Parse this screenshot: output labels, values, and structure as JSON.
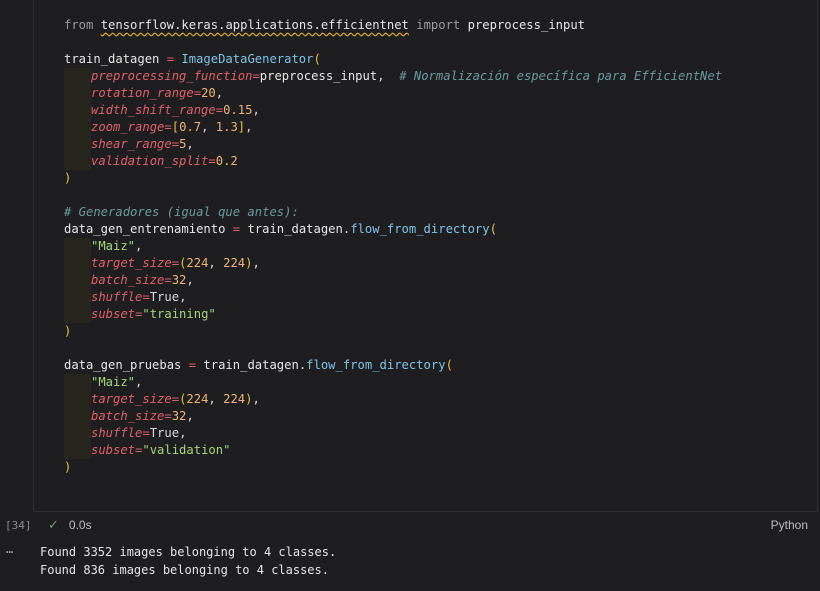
{
  "cell": {
    "execution_count": "[34]",
    "status": "0.0s",
    "language": "Python"
  },
  "code": {
    "l1": {
      "from": "from",
      "module": "tensorflow.keras.applications.efficientnet",
      "import": "import",
      "name": "preprocess_input"
    },
    "l2": {
      "var": "train_datagen",
      "eq": " = ",
      "call": "ImageDataGenerator",
      "open": "("
    },
    "l3": {
      "param": "preprocessing_function",
      "eq": "=",
      "value": "preprocess_input",
      "comma": ",  ",
      "comment": "# Normalización específica para EfficientNet"
    },
    "l4": {
      "param": "rotation_range",
      "eq": "=",
      "value": "20",
      "comma": ","
    },
    "l5": {
      "param": "width_shift_range",
      "eq": "=",
      "value": "0.15",
      "comma": ","
    },
    "l6": {
      "param": "zoom_range",
      "eq": "=",
      "open": "[",
      "v1": "0.7",
      "sep": ", ",
      "v2": "1.3",
      "close": "]",
      "comma": ","
    },
    "l7": {
      "param": "shear_range",
      "eq": "=",
      "value": "5",
      "comma": ","
    },
    "l8": {
      "param": "validation_split",
      "eq": "=",
      "value": "0.2"
    },
    "l9": {
      "close": ")"
    },
    "l10": {
      "comment": "# Generadores (igual que antes):"
    },
    "l11": {
      "var": "data_gen_entrenamiento",
      "eq": " = ",
      "obj": "train_datagen",
      "dot": ".",
      "method": "flow_from_directory",
      "open": "("
    },
    "l12": {
      "str": "\"Maiz\"",
      "comma": ","
    },
    "l13": {
      "param": "target_size",
      "eq": "=",
      "open": "(",
      "v1": "224",
      "sep": ", ",
      "v2": "224",
      "close": ")",
      "comma": ","
    },
    "l14": {
      "param": "batch_size",
      "eq": "=",
      "value": "32",
      "comma": ","
    },
    "l15": {
      "param": "shuffle",
      "eq": "=",
      "value": "True",
      "comma": ","
    },
    "l16": {
      "param": "subset",
      "eq": "=",
      "value": "\"training\""
    },
    "l17": {
      "close": ")"
    },
    "l18": {
      "var": "data_gen_pruebas",
      "eq": " = ",
      "obj": "train_datagen",
      "dot": ".",
      "method": "flow_from_directory",
      "open": "("
    },
    "l19": {
      "str": "\"Maiz\"",
      "comma": ","
    },
    "l20": {
      "param": "target_size",
      "eq": "=",
      "open": "(",
      "v1": "224",
      "sep": ", ",
      "v2": "224",
      "close": ")",
      "comma": ","
    },
    "l21": {
      "param": "batch_size",
      "eq": "=",
      "value": "32",
      "comma": ","
    },
    "l22": {
      "param": "shuffle",
      "eq": "=",
      "value": "True",
      "comma": ","
    },
    "l23": {
      "param": "subset",
      "eq": "=",
      "value": "\"validation\""
    },
    "l24": {
      "close": ")"
    }
  },
  "output": {
    "more_icon": "…",
    "lines": [
      "Found 3352 images belonging to 4 classes.",
      "Found 836 images belonging to 4 classes."
    ]
  },
  "icons": {
    "status": "check-icon",
    "more": "ellipsis-icon"
  },
  "colors": {
    "background": "#1e1e20",
    "check": "#59a869"
  }
}
